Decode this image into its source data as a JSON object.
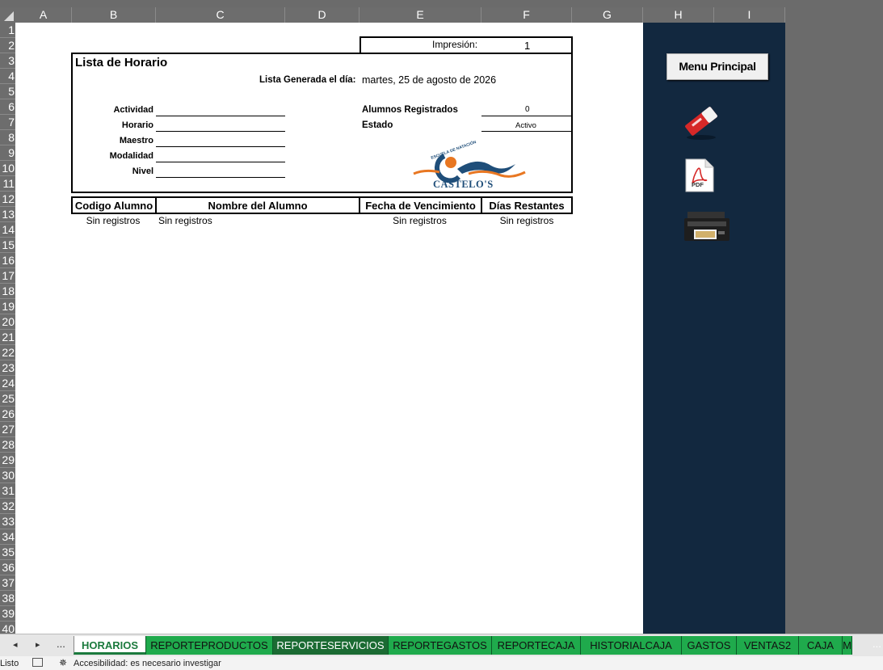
{
  "columns": [
    "A",
    "B",
    "C",
    "D",
    "E",
    "F",
    "G",
    "H",
    "I"
  ],
  "rows": [
    "1",
    "2",
    "3",
    "4",
    "5",
    "6",
    "7",
    "8",
    "9",
    "10",
    "11",
    "12",
    "13",
    "14",
    "15",
    "16",
    "17",
    "18",
    "19",
    "20",
    "21",
    "22",
    "23",
    "24",
    "25",
    "26",
    "27",
    "28",
    "29",
    "30",
    "31",
    "32",
    "33",
    "34",
    "35",
    "36",
    "37",
    "38",
    "39",
    "40"
  ],
  "report": {
    "impresion_label": "Impresión:",
    "impresion_value": "1",
    "title": "Lista de Horario",
    "generated_label": "Lista Generada el día:",
    "generated_value": "martes, 25 de agosto de 2026",
    "fields": {
      "actividad": "Actividad",
      "horario": "Horario",
      "maestro": "Maestro",
      "modalidad": "Modalidad",
      "nivel": "Nivel"
    },
    "alumnos_label": "Alumnos Registrados",
    "alumnos_value": "0",
    "estado_label": "Estado",
    "estado_value": "Activo",
    "logo_top_text": "ESCUELA DE NATACIÓN",
    "logo_text": "CASTELO'S"
  },
  "table": {
    "headers": [
      "Codigo Alumno",
      "Nombre del Alumno",
      "Fecha de Vencimiento",
      "Días Restantes"
    ],
    "row": [
      "Sin registros",
      "Sin registros",
      "Sin registros",
      "Sin registros"
    ]
  },
  "side_panel": {
    "menu_button": "Menu Principal",
    "pdf_label": "PDF"
  },
  "tabs": [
    {
      "label": "HORARIOS",
      "state": "active"
    },
    {
      "label": "REPORTEPRODUCTOS",
      "state": "normal"
    },
    {
      "label": "REPORTESERVICIOS",
      "state": "dark"
    },
    {
      "label": "REPORTEGASTOS",
      "state": "normal"
    },
    {
      "label": "REPORTECAJA",
      "state": "normal"
    },
    {
      "label": "HISTORIALCAJA",
      "state": "normal"
    },
    {
      "label": "GASTOS",
      "state": "normal"
    },
    {
      "label": "VENTAS2",
      "state": "normal"
    },
    {
      "label": "CAJA",
      "state": "normal"
    },
    {
      "label": "M",
      "state": "normal"
    }
  ],
  "tab_nav": {
    "prev": "◂",
    "next": "▸",
    "more_left": "...",
    "more_right": "..."
  },
  "status": {
    "ready": "Listo",
    "accessibility": "Accesibilidad: es necesario investigar"
  },
  "colors": {
    "side_panel": "#12283f",
    "tab_green": "#1faa4c",
    "tab_dark": "#1b6b33",
    "logo_orange": "#e87722",
    "logo_blue": "#1f4e79"
  }
}
